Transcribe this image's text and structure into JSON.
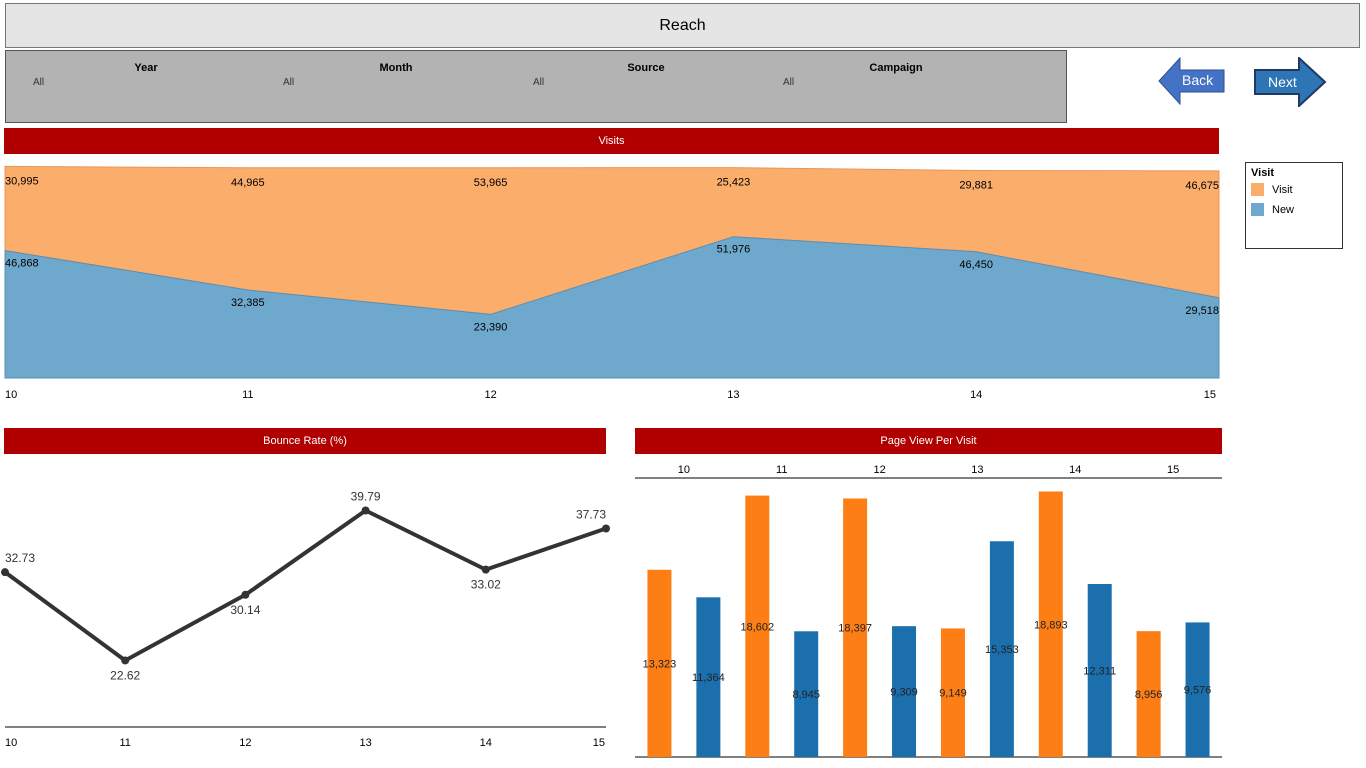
{
  "header": {
    "title": "Reach"
  },
  "filters": [
    {
      "label": "Year",
      "value": "All"
    },
    {
      "label": "Month",
      "value": "All"
    },
    {
      "label": "Source",
      "value": "All"
    },
    {
      "label": "Campaign",
      "value": "All"
    }
  ],
  "nav": {
    "back_label": "Back",
    "next_label": "Next",
    "back_color": "#4472c4",
    "next_color": "#2e75b6"
  },
  "legend": {
    "title": "Visit",
    "items": [
      {
        "label": "Visit",
        "color": "#fbad6b"
      },
      {
        "label": "New",
        "color": "#6fa8cd"
      }
    ]
  },
  "visits": {
    "title": "Visits"
  },
  "bounce": {
    "title": "Bounce Rate (%)"
  },
  "pageview": {
    "title": "Page View Per Visit"
  },
  "chart_data": [
    {
      "type": "area",
      "title": "Visits",
      "categories": [
        "10",
        "11",
        "12",
        "13",
        "14",
        "15"
      ],
      "series": [
        {
          "name": "New",
          "values": [
            46868,
            32385,
            23390,
            51976,
            46450,
            29518
          ],
          "labels": [
            "46,868",
            "32,385",
            "23,390",
            "51,976",
            "46,450",
            "29,518"
          ],
          "color": "#6fa8cd"
        },
        {
          "name": "Visit",
          "values": [
            30995,
            44965,
            53965,
            25423,
            29881,
            46675
          ],
          "labels": [
            "30,995",
            "44,965",
            "53,965",
            "25,423",
            "29,881",
            "46,675"
          ],
          "color": "#fbad6b"
        }
      ],
      "stacked": true,
      "ylim": [
        0,
        78000
      ]
    },
    {
      "type": "line",
      "title": "Bounce Rate (%)",
      "categories": [
        "10",
        "11",
        "12",
        "13",
        "14",
        "15"
      ],
      "values": [
        32.73,
        22.62,
        30.14,
        39.79,
        33.02,
        37.73
      ],
      "labels": [
        "32.73",
        "22.62",
        "30.14",
        "39.79",
        "33.02",
        "37.73"
      ],
      "color": "#333333",
      "ylim": [
        15,
        45
      ]
    },
    {
      "type": "bar",
      "title": "Page View Per Visit",
      "categories": [
        "10",
        "11",
        "12",
        "13",
        "14",
        "15"
      ],
      "bars": [
        {
          "category": "10",
          "value": 13323,
          "label": "13,323",
          "color": "#fd7e14"
        },
        {
          "category": "10",
          "value": 11364,
          "label": "11,364",
          "color": "#1b6fad"
        },
        {
          "category": "11",
          "value": 18602,
          "label": "18,602",
          "color": "#fd7e14"
        },
        {
          "category": "11",
          "value": 8945,
          "label": "8,945",
          "color": "#1b6fad"
        },
        {
          "category": "12",
          "value": 18397,
          "label": "18,397",
          "color": "#fd7e14"
        },
        {
          "category": "12",
          "value": 9309,
          "label": "9,309",
          "color": "#1b6fad"
        },
        {
          "category": "13",
          "value": 9149,
          "label": "9,149",
          "color": "#fd7e14"
        },
        {
          "category": "13",
          "value": 15353,
          "label": "15,353",
          "color": "#1b6fad"
        },
        {
          "category": "14",
          "value": 18893,
          "label": "18,893",
          "color": "#fd7e14"
        },
        {
          "category": "14",
          "value": 12311,
          "label": "12,311",
          "color": "#1b6fad"
        },
        {
          "category": "15",
          "value": 8956,
          "label": "8,956",
          "color": "#fd7e14"
        },
        {
          "category": "15",
          "value": 9576,
          "label": "9,576",
          "color": "#1b6fad"
        }
      ],
      "ylim": [
        0,
        19000
      ]
    }
  ]
}
